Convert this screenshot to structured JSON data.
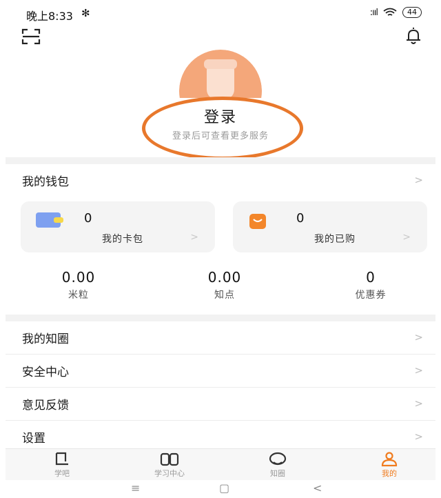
{
  "status": {
    "time": "晚上8:33",
    "bluetooth": "✻",
    "signal": ":ııl",
    "battery": "44"
  },
  "header": {
    "icons": [
      "scan-icon",
      "bell-icon"
    ]
  },
  "profile": {
    "login_label": "登录",
    "login_hint": "登录后可查看更多服务"
  },
  "wallet": {
    "title": "我的钱包",
    "chevron": ">",
    "cards": [
      {
        "count": "0",
        "label": "我的卡包",
        "chevron": ">",
        "icon": "card-wallet-icon",
        "color": "#7ea0f0"
      },
      {
        "count": "0",
        "label": "我的已购",
        "chevron": ">",
        "icon": "shopping-bag-icon",
        "color": "#f3862a"
      }
    ],
    "stats": [
      {
        "value": "0.00",
        "label": "米粒"
      },
      {
        "value": "0.00",
        "label": "知点"
      },
      {
        "value": "0",
        "label": "优惠券"
      }
    ]
  },
  "menu": [
    {
      "label": "我的知圈",
      "chevron": ">"
    },
    {
      "label": "安全中心",
      "chevron": ">"
    },
    {
      "label": "意见反馈",
      "chevron": ">"
    },
    {
      "label": "设置",
      "chevron": ">"
    }
  ],
  "tabs": [
    {
      "label": "学吧",
      "icon": "bookmark-tab-icon"
    },
    {
      "label": "学习中心",
      "icon": "book-icon"
    },
    {
      "label": "知圈",
      "icon": "chat-bubble-icon"
    },
    {
      "label": "我的",
      "icon": "person-icon",
      "active": true
    }
  ],
  "system_nav": {
    "menu": "≡",
    "home": "▢",
    "back": "<"
  },
  "colors": {
    "accent": "#f07c1f",
    "highlight_ring": "#e8782c",
    "avatar": "#f4a77a"
  }
}
